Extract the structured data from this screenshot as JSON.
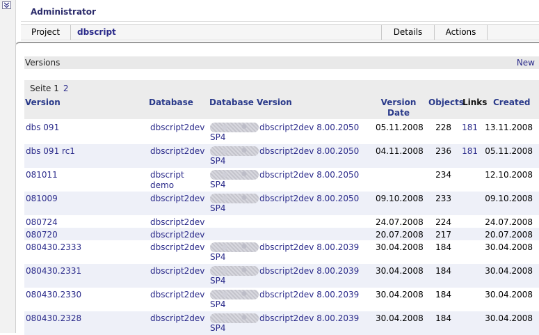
{
  "header": {
    "user": "Administrator"
  },
  "project_bar": {
    "project_label": "Project",
    "project_name": "dbscript",
    "details": "Details",
    "actions": "Actions"
  },
  "versions": {
    "title": "Versions",
    "new_link": "New",
    "pager": {
      "label": "Seite 1",
      "other_page": "2"
    },
    "columns": {
      "version": "Version",
      "database": "Database",
      "database_version": "Database Version",
      "version_date": "Version Date",
      "objects": "Objects",
      "links": "Links",
      "created": "Created"
    },
    "rows": [
      {
        "version": "dbs 091",
        "database": "dbscript2dev",
        "server": "SP4",
        "db_version": "dbscript2dev 8.00.2050",
        "version_date": "05.11.2008",
        "objects": "228",
        "links": "181",
        "created": "13.11.2008"
      },
      {
        "version": "dbs 091 rc1",
        "database": "dbscript2dev",
        "server": "SP4",
        "db_version": "dbscript2dev 8.00.2050",
        "version_date": "04.11.2008",
        "objects": "236",
        "links": "181",
        "created": "05.11.2008"
      },
      {
        "version": "081011",
        "database": "dbscript demo",
        "server": "SP4",
        "db_version": "dbscript2dev 8.00.2050",
        "version_date": "",
        "objects": "234",
        "links": "",
        "created": "12.10.2008"
      },
      {
        "version": "081009",
        "database": "dbscript2dev",
        "server": "SP4",
        "db_version": "dbscript2dev 8.00.2050",
        "version_date": "09.10.2008",
        "objects": "233",
        "links": "",
        "created": "09.10.2008"
      },
      {
        "version": "080724",
        "database": "dbscript2dev",
        "server": "",
        "db_version": "",
        "version_date": "24.07.2008",
        "objects": "224",
        "links": "",
        "created": "24.07.2008"
      },
      {
        "version": "080720",
        "database": "dbscript2dev",
        "server": "",
        "db_version": "",
        "version_date": "20.07.2008",
        "objects": "217",
        "links": "",
        "created": "20.07.2008"
      },
      {
        "version": "080430.2333",
        "database": "dbscript2dev",
        "server": "SP4",
        "db_version": "dbscript2dev 8.00.2039",
        "version_date": "30.04.2008",
        "objects": "184",
        "links": "",
        "created": "30.04.2008"
      },
      {
        "version": "080430.2331",
        "database": "dbscript2dev",
        "server": "SP4",
        "db_version": "dbscript2dev 8.00.2039",
        "version_date": "30.04.2008",
        "objects": "184",
        "links": "",
        "created": "30.04.2008"
      },
      {
        "version": "080430.2330",
        "database": "dbscript2dev",
        "server": "SP4",
        "db_version": "dbscript2dev 8.00.2039",
        "version_date": "30.04.2008",
        "objects": "184",
        "links": "",
        "created": "30.04.2008"
      },
      {
        "version": "080430.2328",
        "database": "dbscript2dev",
        "server": "SP4",
        "db_version": "dbscript2dev 8.00.2039",
        "version_date": "30.04.2008",
        "objects": "184",
        "links": "",
        "created": "30.04.2008"
      }
    ]
  },
  "icons": {
    "collapse": "double-chevron-down-icon"
  }
}
